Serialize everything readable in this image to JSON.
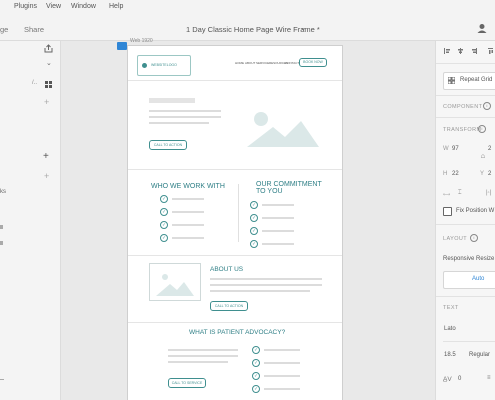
{
  "menu": [
    "Plugins",
    "View",
    "Window",
    "Help"
  ],
  "tabs": {
    "left1": "ge",
    "left2": "Share"
  },
  "document": {
    "title": "1 Day Classic Home Page Wire Frame *"
  },
  "left_panel": {
    "row_label": "ks"
  },
  "artboard_label": "Web 1920",
  "wireframe": {
    "logo": "WEBSITELOGO",
    "nav": [
      "HOME",
      "ABOUT",
      "SERVICE",
      "RESOURCES",
      "CONTACT"
    ],
    "nav_button": "BOOK NOW",
    "hero_cta": "CALL TO ACTION",
    "who_title": "WHO WE WORK WITH",
    "commit_title_1": "OUR COMMITMENT",
    "commit_title_2": "TO YOU",
    "about_title": "ABOUT US",
    "about_cta": "CALL TO ACTION",
    "advocacy_title": "WHAT IS PATIENT ADVOCACY?",
    "advocacy_cta": "CALL TO SERVICE"
  },
  "right_panel": {
    "repeat_grid": "Repeat Grid",
    "component": "COMPONENT",
    "transform": "TRANSFORM",
    "w_label": "W",
    "w_value": "97",
    "h_label": "H",
    "h_value": "22",
    "x_label": "X",
    "y_label": "Y",
    "y_value": "2",
    "fix_position": "Fix Position W",
    "layout": "LAYOUT",
    "responsive_resize": "Responsive Resize",
    "auto": "Auto",
    "text": "TEXT",
    "font": "Lato",
    "font_size": "18.5",
    "font_weight": "Regular",
    "spacing": "0"
  },
  "colors": {
    "teal": "#2f7f86",
    "accent_blue": "#2f86d6"
  }
}
